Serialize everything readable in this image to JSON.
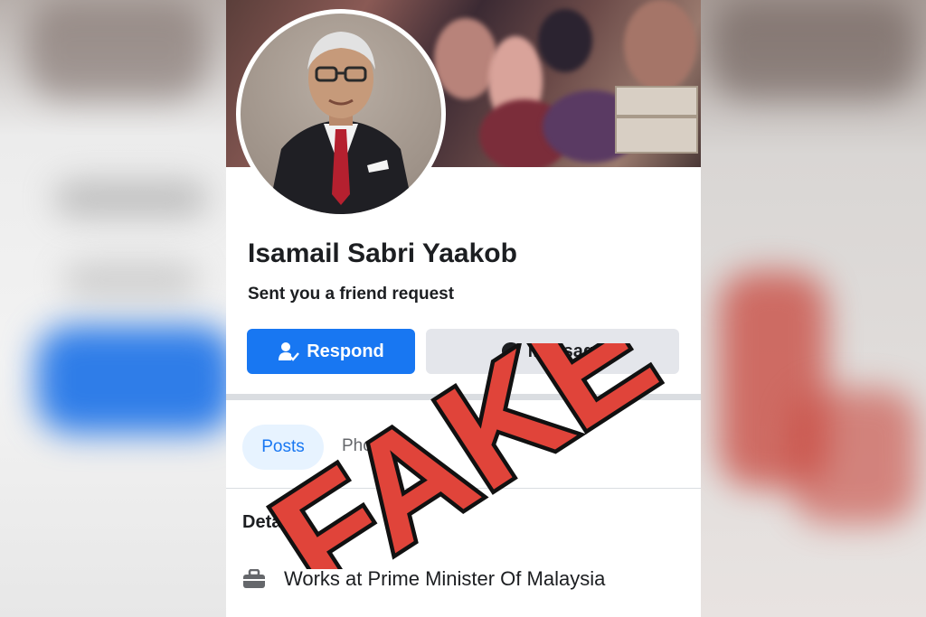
{
  "profile": {
    "name": "Isamail Sabri Yaakob",
    "status_text": "Sent you a friend request"
  },
  "actions": {
    "respond_label": "Respond",
    "message_label": "Message"
  },
  "tabs": [
    {
      "label": "Posts",
      "active": true
    },
    {
      "label": "Photos",
      "active": false
    }
  ],
  "details": {
    "heading": "Details",
    "work_text": "Works at Prime Minister Of Malaysia"
  },
  "overlay": {
    "stamp_text": "FAKE",
    "stamp_color": "#e0443a"
  },
  "colors": {
    "accent": "#1877f2",
    "tab_active_bg": "#e7f3ff"
  },
  "icons": {
    "respond": "person-check-icon",
    "message": "messenger-icon",
    "work": "briefcase-icon"
  }
}
